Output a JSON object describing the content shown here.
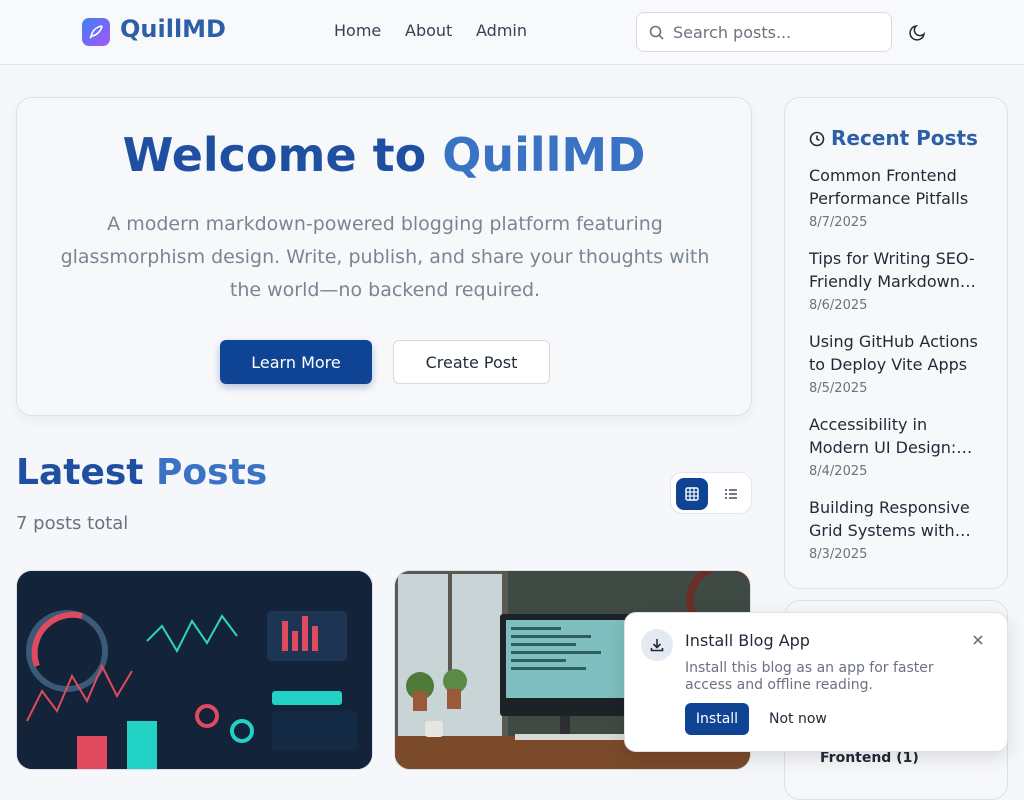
{
  "header": {
    "brand": "QuillMD",
    "logo_icon": "quill-icon",
    "nav": [
      "Home",
      "About",
      "Admin"
    ],
    "search_placeholder": "Search posts...",
    "theme_icon": "moon-icon"
  },
  "hero": {
    "title_part1": "Welcome to ",
    "title_part2": "QuillMD",
    "description": "A modern markdown-powered blogging platform featuring glassmorphism design. Write, publish, and share your thoughts with the world—no backend required.",
    "primary_button": "Learn More",
    "secondary_button": "Create Post"
  },
  "latest": {
    "title_part1": "Latest ",
    "title_part2": "Posts",
    "count": "7 posts total",
    "view_toggle": [
      "grid-icon",
      "list-icon"
    ],
    "cards": [
      {
        "image": "dashboard-image"
      },
      {
        "image": "desk-computer-image"
      }
    ]
  },
  "sidebar": {
    "title": "Recent Posts",
    "icon": "clock-icon",
    "posts": [
      {
        "title": "Common Frontend Performance Pitfalls",
        "date": "8/7/2025"
      },
      {
        "title": "Tips for Writing SEO-Friendly Markdown Posts",
        "date": "8/6/2025"
      },
      {
        "title": "Using GitHub Actions to Deploy Vite Apps",
        "date": "8/5/2025"
      },
      {
        "title": "Accessibility in Modern UI Design: Best Practices",
        "date": "8/4/2025"
      },
      {
        "title": "Building Responsive Grid Systems with CSS",
        "date": "8/3/2025"
      }
    ],
    "category": "Frontend (1)"
  },
  "install_prompt": {
    "title": "Install Blog App",
    "description": "Install this blog as an app for faster access and offline reading.",
    "install_label": "Install",
    "dismiss_label": "Not now",
    "icon": "download-icon"
  },
  "colors": {
    "brand": "#2c5fa8",
    "primary_button": "#0f4494",
    "background": "#f5f7fa"
  }
}
